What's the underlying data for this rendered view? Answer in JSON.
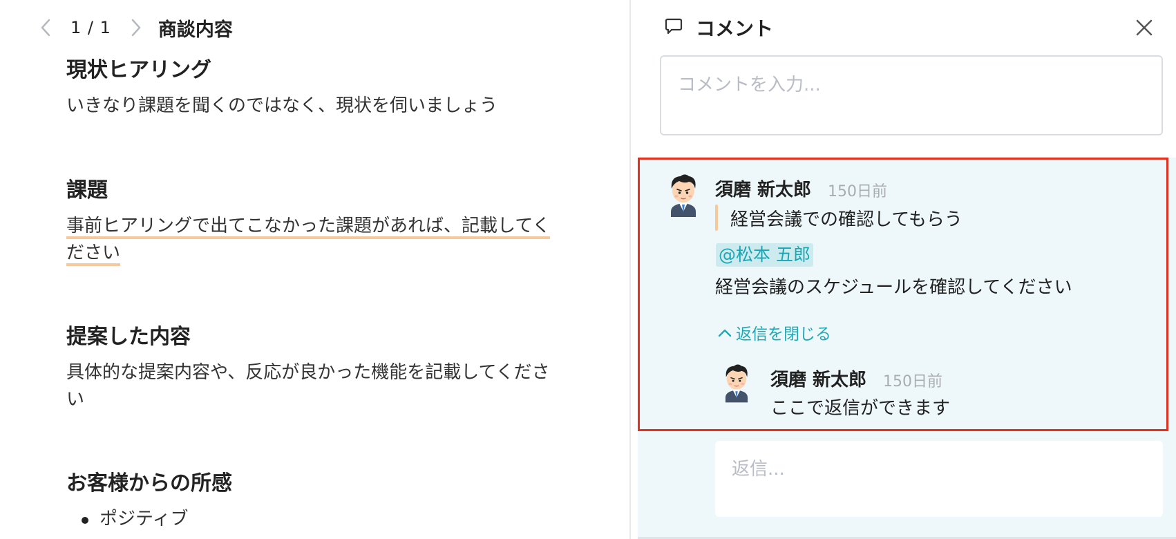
{
  "pager": {
    "count": "1 / 1",
    "title": "商談内容"
  },
  "document": {
    "sections": [
      {
        "heading": "現状ヒアリング",
        "text": "いきなり課題を聞くのではなく、現状を伺いましょう"
      },
      {
        "heading": "課題",
        "text": "事前ヒアリングで出てこなかった課題があれば、記載してください"
      },
      {
        "heading": "提案した内容",
        "text": "具体的な提案内容や、反応が良かった機能を記載してください"
      },
      {
        "heading": "お客様からの所感",
        "bullets": [
          "ポジティブ"
        ]
      }
    ]
  },
  "panel": {
    "title": "コメント",
    "comment_placeholder": "コメントを入力...",
    "reply_placeholder": "返信...",
    "toggle_label": "返信を閉じる"
  },
  "comment": {
    "author": "須磨 新太郎",
    "time": "150日前",
    "quote": "経営会議での確認してもらう",
    "mention": "@松本 五郎",
    "body": "経営会議のスケジュールを確認してください"
  },
  "reply": {
    "author": "須磨 新太郎",
    "time": "150日前",
    "body": "ここで返信ができます"
  },
  "colors": {
    "accent": "#1fa8b5",
    "highlight_border": "#e0301e",
    "underline": "#f6c99d",
    "thread_bg": "#eef8fa"
  },
  "icons": [
    "chevron-left-icon",
    "chevron-right-icon",
    "comment-icon",
    "close-icon",
    "chevron-up-icon",
    "user-avatar"
  ]
}
